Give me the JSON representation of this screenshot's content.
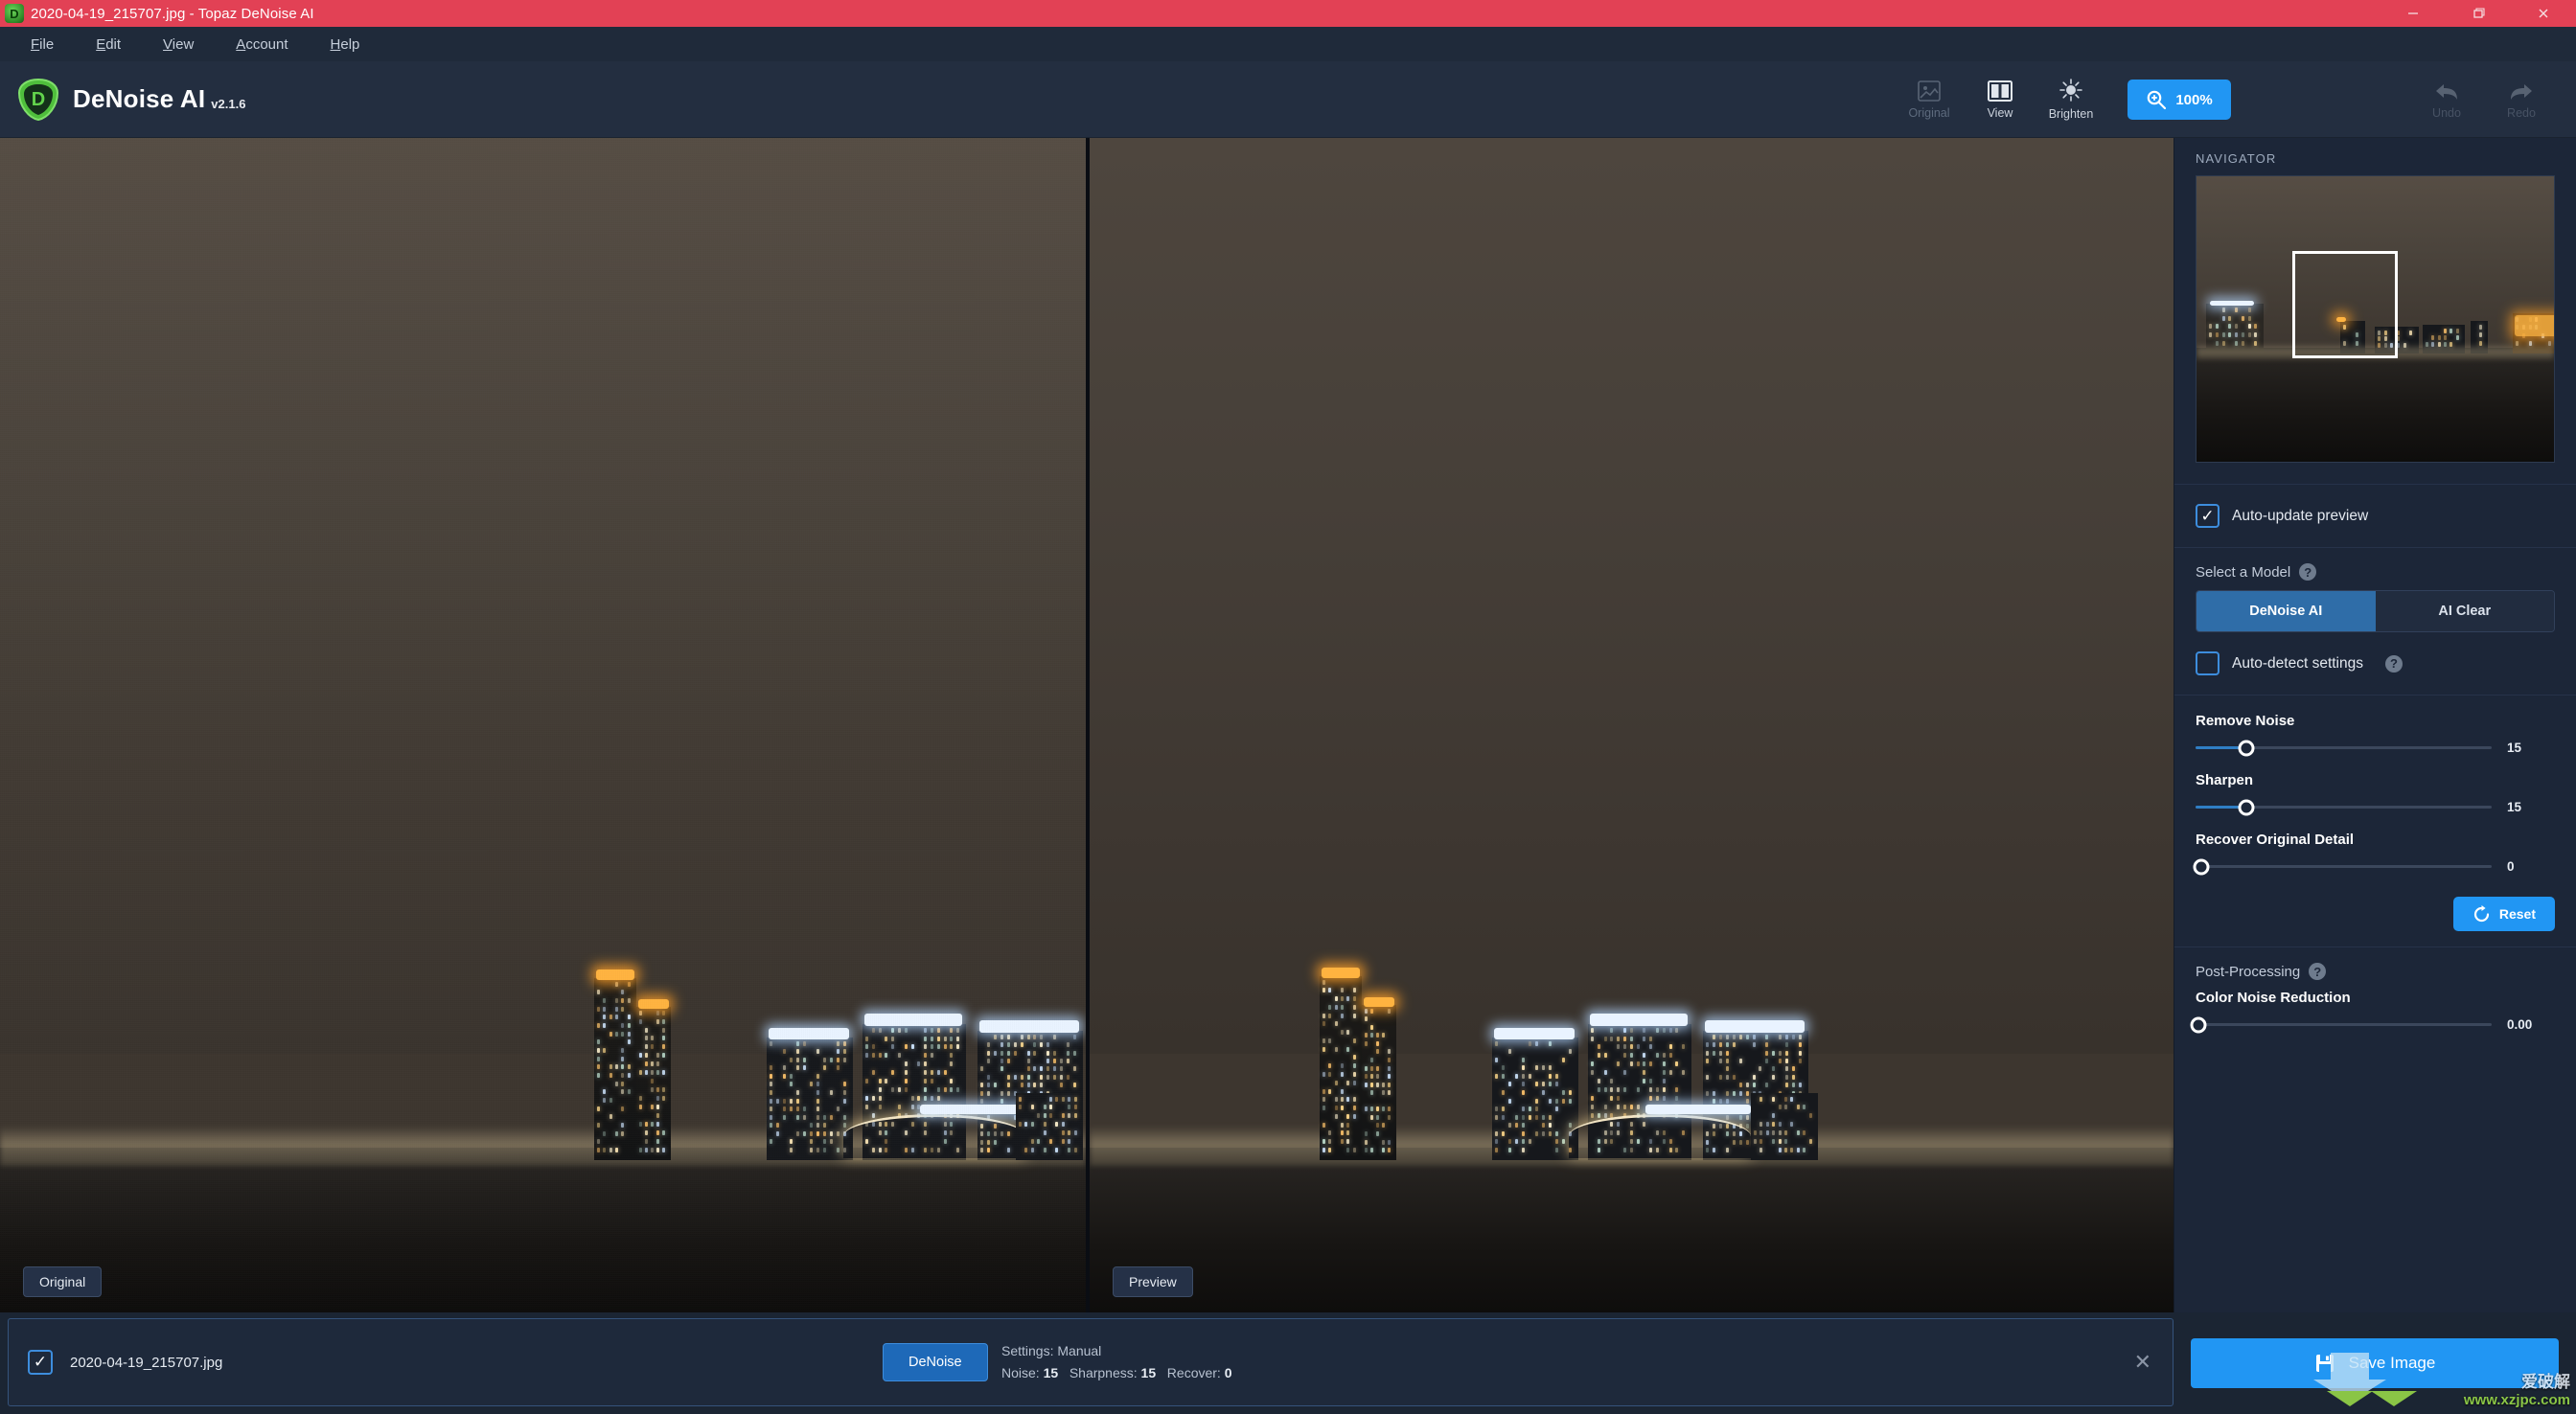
{
  "titlebar": {
    "title": "2020-04-19_215707.jpg - Topaz DeNoise AI",
    "app_icon": "topaz-denoise-logo-icon",
    "minimize": "minimize-icon",
    "maximize": "restore-icon",
    "close": "close-icon"
  },
  "menubar": {
    "items": [
      {
        "label": "File",
        "mnemonic": "F"
      },
      {
        "label": "Edit",
        "mnemonic": "E"
      },
      {
        "label": "View",
        "mnemonic": "V"
      },
      {
        "label": "Account",
        "mnemonic": "A"
      },
      {
        "label": "Help",
        "mnemonic": "H"
      }
    ]
  },
  "brand": {
    "name": "DeNoise AI",
    "version": "v2.1.6"
  },
  "toolbar": {
    "original_label": "Original",
    "view_label": "View",
    "brighten_label": "Brighten",
    "zoom_level": "100%",
    "undo_label": "Undo",
    "redo_label": "Redo"
  },
  "viewer": {
    "left_tag": "Original",
    "right_tag": "Preview"
  },
  "sidebar": {
    "navigator_title": "NAVIGATOR",
    "auto_update": {
      "label": "Auto-update preview",
      "checked": true
    },
    "model_section": {
      "title": "Select a Model",
      "help": "?"
    },
    "model_options": [
      {
        "label": "DeNoise AI",
        "active": true
      },
      {
        "label": "AI Clear",
        "active": false
      }
    ],
    "auto_detect": {
      "label": "Auto-detect settings",
      "checked": false,
      "help": "?"
    },
    "sliders": [
      {
        "label": "Remove Noise",
        "value": "15",
        "percent": 17
      },
      {
        "label": "Sharpen",
        "value": "15",
        "percent": 17
      },
      {
        "label": "Recover Original Detail",
        "value": "0",
        "percent": 2
      }
    ],
    "reset_label": "Reset",
    "post_section": {
      "title": "Post-Processing",
      "help": "?"
    },
    "post_sliders": [
      {
        "label": "Color Noise Reduction",
        "value": "0.00",
        "percent": 1
      }
    ]
  },
  "bottom": {
    "file": {
      "name": "2020-04-19_215707.jpg",
      "checked": true
    },
    "denoise_label": "DeNoise",
    "settings_line": "Settings: Manual",
    "params_prefix_noise": "Noise:",
    "params_noise": "15",
    "params_prefix_sharp": "Sharpness:",
    "params_sharp": "15",
    "params_prefix_recover": "Recover:",
    "params_recover": "0",
    "close_row": "close-icon",
    "save_label": "Save Image"
  },
  "watermark": {
    "cn": "爱破解",
    "url": "www.xzjpc.com"
  },
  "colors": {
    "titlebar": "#e24155",
    "accent_blue": "#2196f3",
    "panel_bg": "#1c2638",
    "header_bg": "#232e40"
  }
}
